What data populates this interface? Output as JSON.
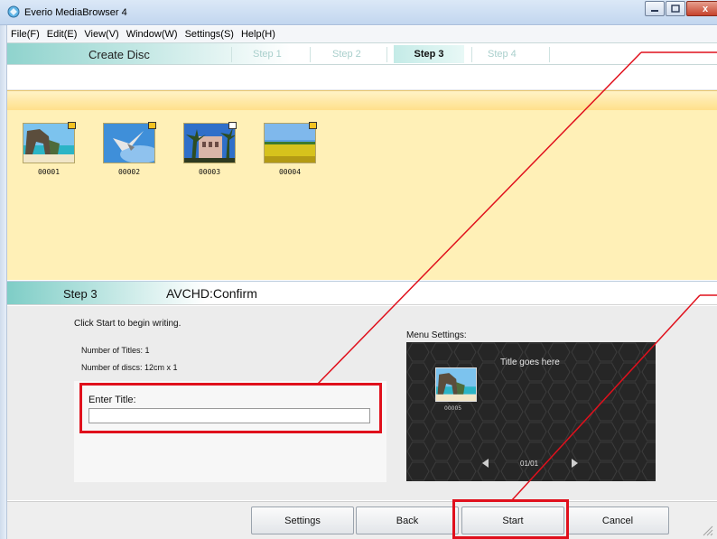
{
  "window": {
    "title": "Everio MediaBrowser 4",
    "close_glyph": "x",
    "icons": {
      "app": "app-icon",
      "minimize": "minimize-icon",
      "maximize": "maximize-icon",
      "close": "close-icon"
    }
  },
  "menu": {
    "items": [
      {
        "label": "File(F)"
      },
      {
        "label": "Edit(E)"
      },
      {
        "label": "View(V)"
      },
      {
        "label": "Window(W)"
      },
      {
        "label": "Settings(S)"
      },
      {
        "label": "Help(H)"
      }
    ]
  },
  "steps": {
    "heading": "Create Disc",
    "items": [
      {
        "label": "Step 1",
        "active": false
      },
      {
        "label": "Step 2",
        "active": false
      },
      {
        "label": "Step 3",
        "active": true
      },
      {
        "label": "Step 4",
        "active": false
      }
    ]
  },
  "thumbnails": {
    "items": [
      {
        "caption": "00001",
        "badge_color": "#f3c221",
        "scene": "sea-arch"
      },
      {
        "caption": "00002",
        "badge_color": "#f3c221",
        "scene": "seagull-sky"
      },
      {
        "caption": "00003",
        "badge_color": "#ffffff",
        "scene": "palm-building"
      },
      {
        "caption": "00004",
        "badge_color": "#f3c221",
        "scene": "flower-field"
      }
    ]
  },
  "confirm": {
    "step": "Step 3",
    "title": "AVCHD:Confirm",
    "instruction": "Click Start to begin writing.",
    "num_titles": "Number of Titles: 1",
    "num_discs": "Number of discs: 12cm x 1",
    "enter_title_label": "Enter Title:",
    "title_value": ""
  },
  "menu_settings": {
    "label": "Menu Settings:",
    "preview_title": "Title goes here",
    "thumb_caption": "00005",
    "page": "01/01"
  },
  "buttons": {
    "settings": "Settings",
    "back": "Back",
    "start": "Start",
    "cancel": "Cancel"
  },
  "colors": {
    "highlight": "#e0101c",
    "thumb_area_bg": "#fff0b7",
    "step_accent": "#8fd3cd"
  }
}
